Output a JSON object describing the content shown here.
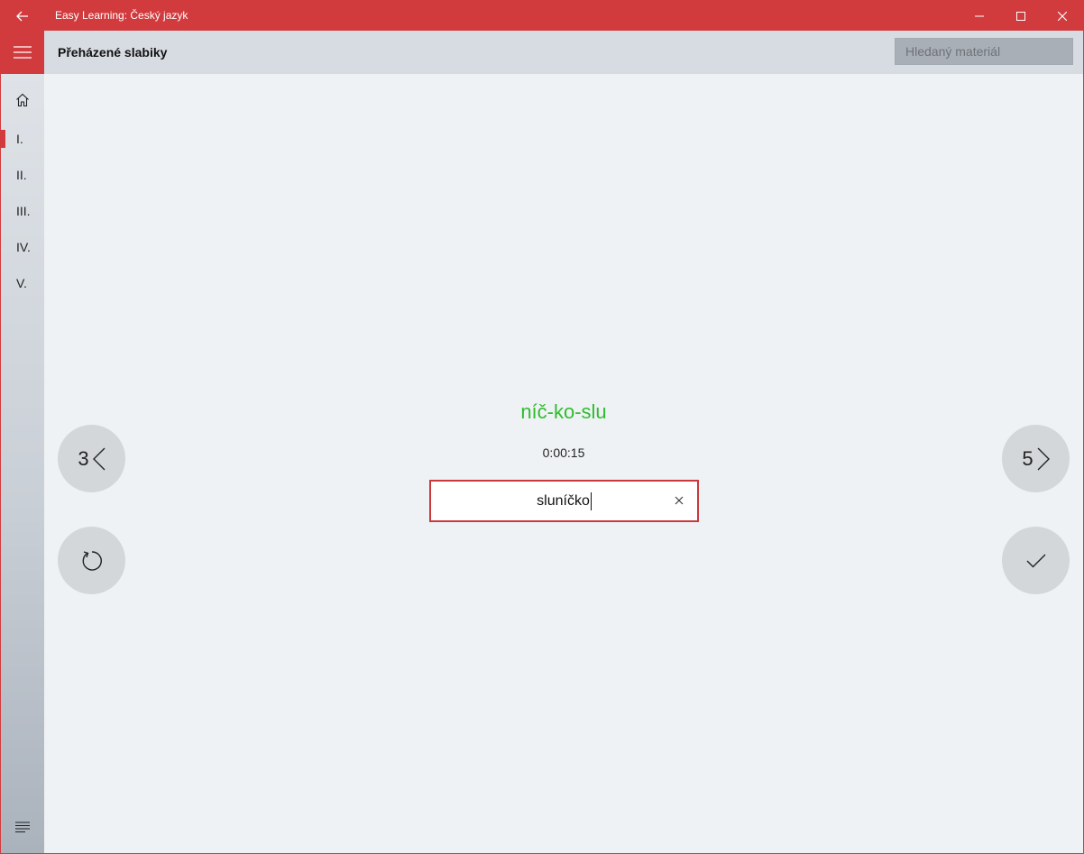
{
  "window": {
    "title": "Easy Learning: Český jazyk",
    "accent_color": "#d13b3e"
  },
  "header": {
    "page_title": "Přeházené slabiky",
    "search_placeholder": "Hledaný materiál"
  },
  "sidebar": {
    "items": [
      {
        "icon": "home-icon"
      },
      {
        "label": "I.",
        "selected": true
      },
      {
        "label": "II."
      },
      {
        "label": "III."
      },
      {
        "label": "IV."
      },
      {
        "label": "V."
      }
    ],
    "bottom_icon": "list-icon"
  },
  "exercise": {
    "scrambled_word": "níč-ko-slu",
    "scrambled_color": "#2ebd2e",
    "timer": "0:00:15",
    "answer_value": "sluníčko"
  },
  "navigation": {
    "prev_number": "3",
    "next_number": "5"
  }
}
